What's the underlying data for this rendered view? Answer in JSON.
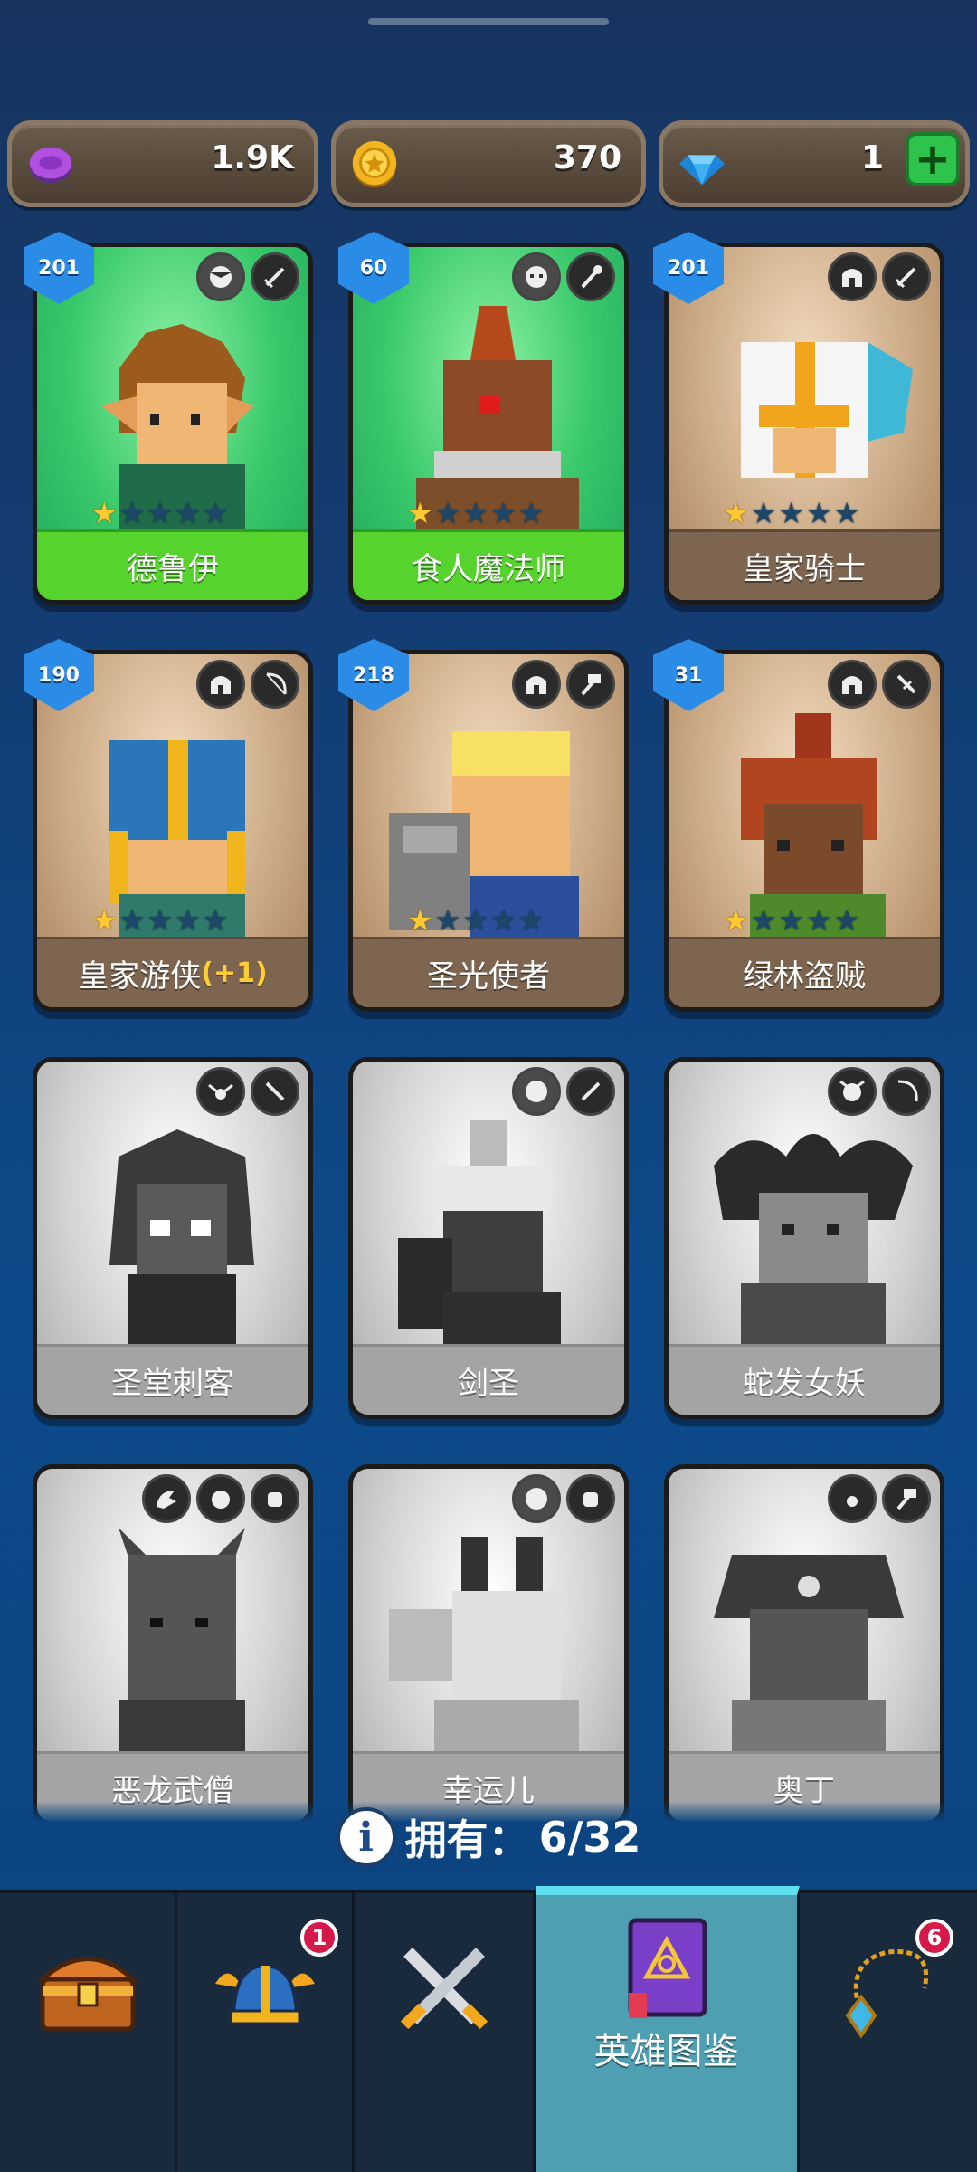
{
  "currency": {
    "gems_purple": "1.9K",
    "coins": "370",
    "diamonds": "1",
    "add_label": "+"
  },
  "heroes": [
    {
      "name": "德鲁伊",
      "level": "201",
      "stars": 1,
      "bonus": ""
    },
    {
      "name": "食人魔法师",
      "level": "60",
      "stars": 1,
      "bonus": ""
    },
    {
      "name": "皇家骑士",
      "level": "201",
      "stars": 1,
      "bonus": ""
    },
    {
      "name": "皇家游侠",
      "level": "190",
      "stars": 1,
      "bonus": "(+1)"
    },
    {
      "name": "圣光使者",
      "level": "218",
      "stars": 1,
      "bonus": ""
    },
    {
      "name": "绿林盗贼",
      "level": "31",
      "stars": 1,
      "bonus": ""
    },
    {
      "name": "圣堂刺客"
    },
    {
      "name": "剑圣"
    },
    {
      "name": "蛇发女妖"
    },
    {
      "name": "恶龙武僧"
    },
    {
      "name": "幸运儿"
    },
    {
      "name": "奥丁"
    }
  ],
  "owned": {
    "label": "拥有：",
    "count": "6/32",
    "info": "i"
  },
  "nav": {
    "items": [
      {
        "icon": "treasure-chest-icon"
      },
      {
        "icon": "viking-helmet-icon",
        "badge": "1"
      },
      {
        "icon": "crossed-swords-icon"
      },
      {
        "icon": "hero-book-icon",
        "label": "英雄图鉴"
      },
      {
        "icon": "amulet-icon",
        "badge": "6"
      }
    ]
  },
  "colors": {
    "background": "#0b4480",
    "green_card": "#56d42d",
    "tan_card": "#7d6550",
    "locked_card": "#a4a4a4",
    "active_tab": "#4f9fb3",
    "badge": "#d51a4a"
  }
}
